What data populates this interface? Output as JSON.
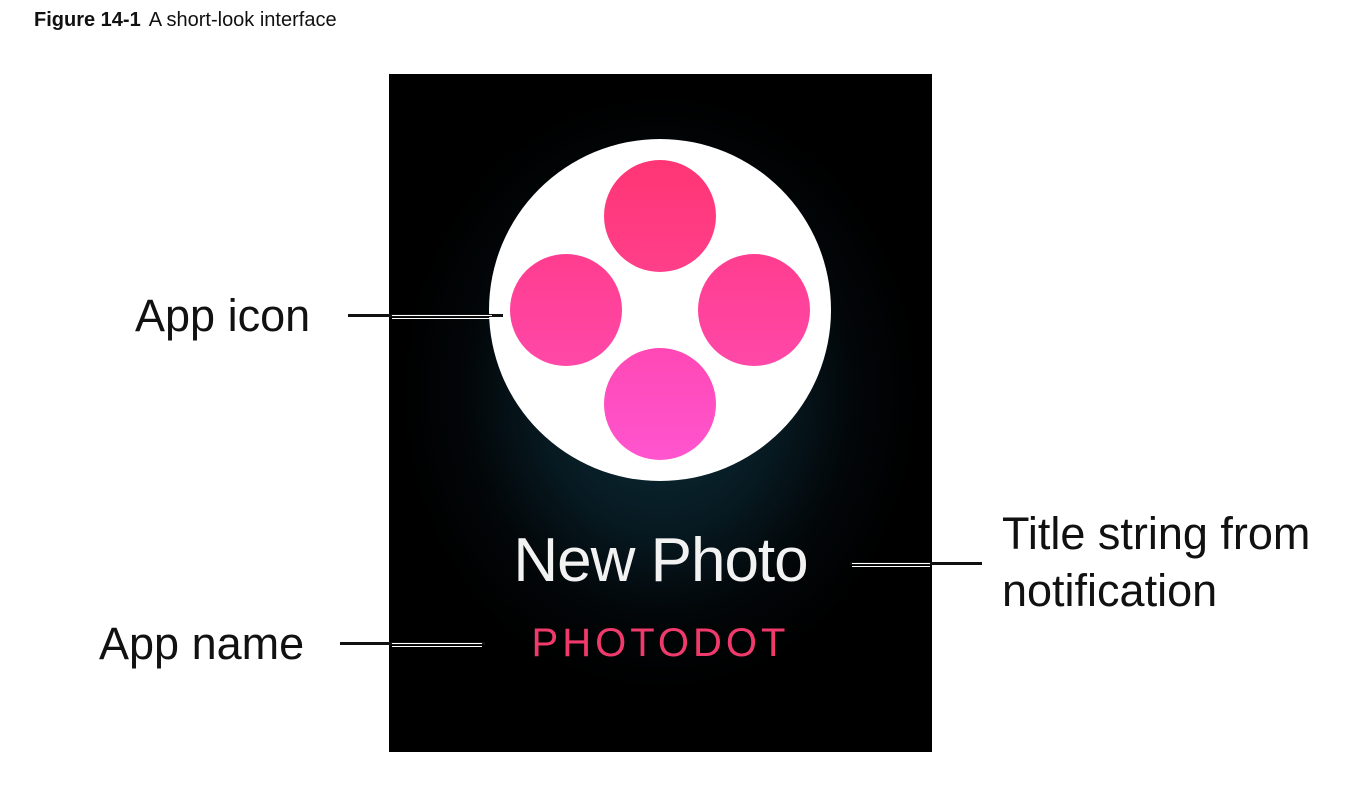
{
  "figure": {
    "number": "Figure 14-1",
    "caption": "A short-look interface"
  },
  "notification": {
    "title": "New Photo",
    "app_name": "PHOTODOT",
    "app_name_color": "#f03a6c",
    "icon_dot_color": "#ff3f8a"
  },
  "callouts": {
    "app_icon": "App icon",
    "app_name": "App name",
    "title_line1": "Title string from",
    "title_line2": "notification"
  }
}
